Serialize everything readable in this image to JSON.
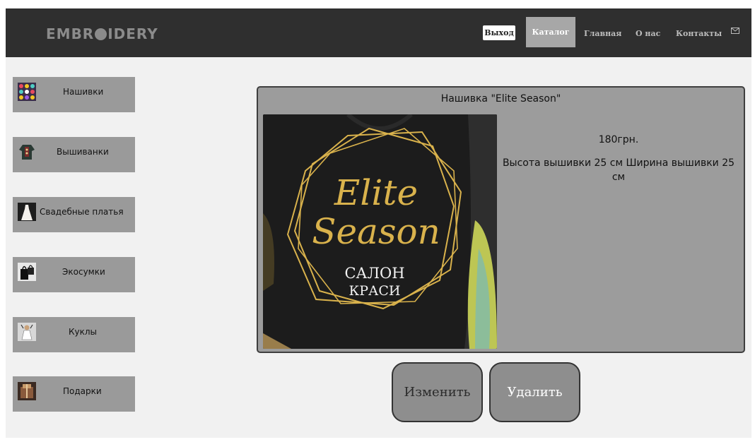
{
  "header": {
    "logo_left": "EMBR",
    "logo_right": "IDERY",
    "logout_label": "Выход",
    "nav": [
      {
        "label": "Каталог",
        "active": true
      },
      {
        "label": "Главная"
      },
      {
        "label": "О нас"
      },
      {
        "label": "Контакты"
      }
    ],
    "mail_icon": "envelope-icon"
  },
  "sidebar": {
    "items": [
      {
        "label": "Нашивки",
        "icon": "patches-thumbnail"
      },
      {
        "label": "Вышиванки",
        "icon": "embroidered-shirt-thumbnail"
      },
      {
        "label": "Свадебные платья",
        "icon": "wedding-dress-thumbnail"
      },
      {
        "label": "Экосумки",
        "icon": "eco-bag-thumbnail"
      },
      {
        "label": "Куклы",
        "icon": "doll-thumbnail"
      },
      {
        "label": "Подарки",
        "icon": "gift-thumbnail"
      }
    ]
  },
  "product": {
    "title": "Нашивка \"Elite Season\"",
    "price": "180грн.",
    "dimensions": "Высота вышивки 25 см Ширина вышивки 25 см",
    "image_text": {
      "line1": "Elite",
      "line2": "Season",
      "line3": "САЛОН",
      "line4": "КРАСИ"
    }
  },
  "actions": {
    "edit_label": "Изменить",
    "delete_label": "Удалить"
  },
  "colors": {
    "header_bg": "#2f2f2f",
    "page_bg": "#f1f1f1",
    "button_gray": "#9a9a9a",
    "embroidery_gold": "#d9b24c"
  }
}
